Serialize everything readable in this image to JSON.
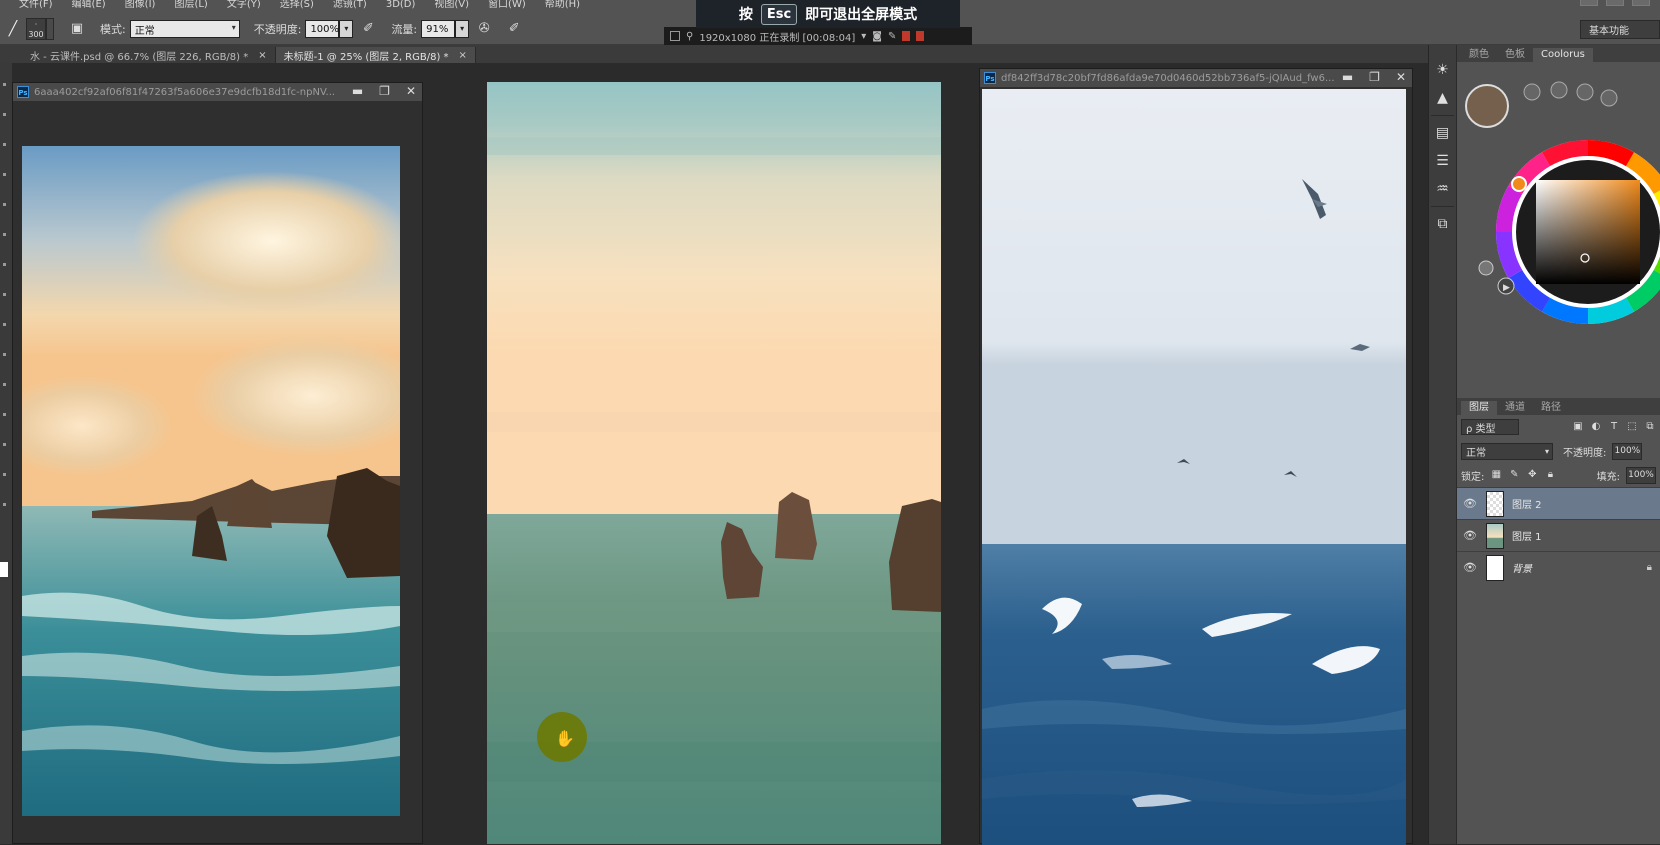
{
  "menubar": {
    "items": [
      "文件(F)",
      "编辑(E)",
      "图像(I)",
      "图层(L)",
      "文字(Y)",
      "选择(S)",
      "滤镜(T)",
      "3D(D)",
      "视图(V)",
      "窗口(W)",
      "帮助(H)"
    ]
  },
  "options": {
    "brush_size": "300",
    "mode_label": "模式:",
    "mode_value": "正常",
    "opacity_label": "不透明度:",
    "opacity_value": "100%",
    "flow_label": "流量:",
    "flow_value": "91%",
    "workspace": "基本功能"
  },
  "fullscreen_hint": {
    "prefix": "按",
    "key": "Esc",
    "suffix": "即可退出全屏模式"
  },
  "status_strip": {
    "text": "1920x1080 正在录制 [00:08:04]"
  },
  "tabs": [
    {
      "label": "水 - 云课件.psd @ 66.7% (图层 226, RGB/8) *",
      "close": "×"
    },
    {
      "label": "未标题-1 @ 25% (图层 2, RGB/8) *",
      "close": "×"
    }
  ],
  "windows": {
    "left": {
      "badge": "Ps",
      "title": "6aaa402cf92af06f81f47263f5a606e37e9dcfb18d1fc-npNV...",
      "min": "▬",
      "max": "❐",
      "close": "✕"
    },
    "right": {
      "badge": "Ps",
      "title": "df842ff3d78c20bf7fd86afda9e70d0460d52bb736af5-jQIAud_fw6...",
      "min": "▬",
      "max": "❐",
      "close": "✕"
    }
  },
  "panel": {
    "color_tabs": [
      "颜色",
      "色板",
      "Coolorus"
    ],
    "layers_tabs": [
      "图层",
      "通道",
      "路径"
    ],
    "kind": "ρ 类型",
    "blend_mode": "正常",
    "opacity_label": "不透明度:",
    "opacity_value": "100%",
    "lock_label": "锁定:",
    "fill_label": "填充:",
    "fill_value": "100%",
    "layers": [
      {
        "name": "图层 2",
        "selected": true
      },
      {
        "name": "图层 1",
        "selected": false
      },
      {
        "name": "背景",
        "selected": false,
        "locked": true
      }
    ]
  },
  "colors": {
    "foreground": "#74604c",
    "background": "#ffffff",
    "hand_cursor": "#6b7a05"
  }
}
